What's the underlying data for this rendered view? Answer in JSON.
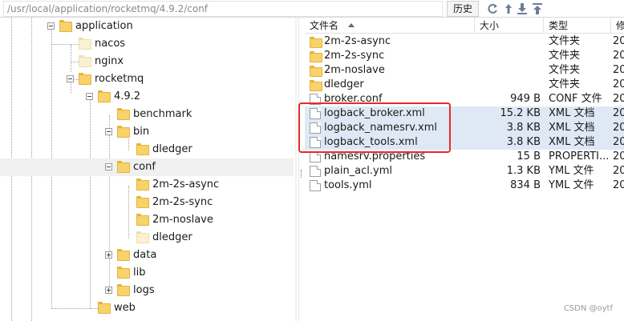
{
  "pathbar": {
    "path": "/usr/local/application/rocketmq/4.9.2/conf",
    "history_label": "历史",
    "tools": [
      "refresh-icon",
      "up-arrow-icon",
      "download-icon",
      "upload-icon"
    ]
  },
  "tree": {
    "items": [
      {
        "label": "application"
      },
      {
        "label": "nacos"
      },
      {
        "label": "nginx"
      },
      {
        "label": "rocketmq"
      },
      {
        "label": "4.9.2"
      },
      {
        "label": "benchmark"
      },
      {
        "label": "bin"
      },
      {
        "label": "dledger"
      },
      {
        "label": "conf"
      },
      {
        "label": "2m-2s-async"
      },
      {
        "label": "2m-2s-sync"
      },
      {
        "label": "2m-noslave"
      },
      {
        "label": "dledger"
      },
      {
        "label": "data"
      },
      {
        "label": "lib"
      },
      {
        "label": "logs"
      },
      {
        "label": "web"
      }
    ]
  },
  "list": {
    "headers": {
      "name": "文件名",
      "size": "大小",
      "type": "类型",
      "modified": "修改"
    },
    "files": [
      {
        "name": "2m-2s-async",
        "size": "",
        "type": "文件夹",
        "mod": "20"
      },
      {
        "name": "2m-2s-sync",
        "size": "",
        "type": "文件夹",
        "mod": "20"
      },
      {
        "name": "2m-noslave",
        "size": "",
        "type": "文件夹",
        "mod": "20"
      },
      {
        "name": "dledger",
        "size": "",
        "type": "文件夹",
        "mod": "20"
      },
      {
        "name": "broker.conf",
        "size": "949 B",
        "type": "CONF 文件",
        "mod": "20"
      },
      {
        "name": "logback_broker.xml",
        "size": "15.2 KB",
        "type": "XML 文档",
        "mod": "20"
      },
      {
        "name": "logback_namesrv.xml",
        "size": "3.8 KB",
        "type": "XML 文档",
        "mod": "20"
      },
      {
        "name": "logback_tools.xml",
        "size": "3.8 KB",
        "type": "XML 文档",
        "mod": "20"
      },
      {
        "name": "namesrv.properties",
        "size": "15 B",
        "type": "PROPERTI...",
        "mod": "20"
      },
      {
        "name": "plain_acl.yml",
        "size": "1.3 KB",
        "type": "YML 文件",
        "mod": "20"
      },
      {
        "name": "tools.yml",
        "size": "834 B",
        "type": "YML 文件",
        "mod": "20"
      }
    ]
  },
  "watermark": "CSDN @oytf",
  "colors": {
    "highlight_box": "#e8292a",
    "row_highlight": "#dfe9f5",
    "folder": "#f8d26a"
  }
}
